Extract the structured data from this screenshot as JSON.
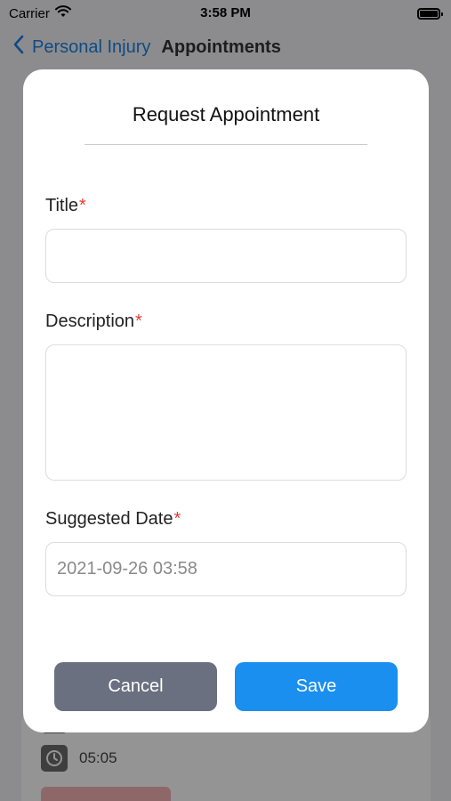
{
  "status_bar": {
    "carrier": "Carrier",
    "time": "3:58 PM"
  },
  "nav": {
    "back_label": "Personal Injury",
    "title": "Appointments"
  },
  "background": {
    "time_value": "05:05"
  },
  "modal": {
    "title": "Request Appointment",
    "fields": {
      "title": {
        "label": "Title",
        "required_mark": "*",
        "value": ""
      },
      "description": {
        "label": "Description",
        "required_mark": "*",
        "value": ""
      },
      "suggested_date": {
        "label": "Suggested Date",
        "required_mark": "*",
        "value": "2021-09-26 03:58"
      }
    },
    "buttons": {
      "cancel": "Cancel",
      "save": "Save"
    }
  },
  "colors": {
    "accent": "#1a8ff0",
    "cancel": "#6b7080",
    "required": "#e23b3b",
    "nav_link": "#1a82e0"
  }
}
